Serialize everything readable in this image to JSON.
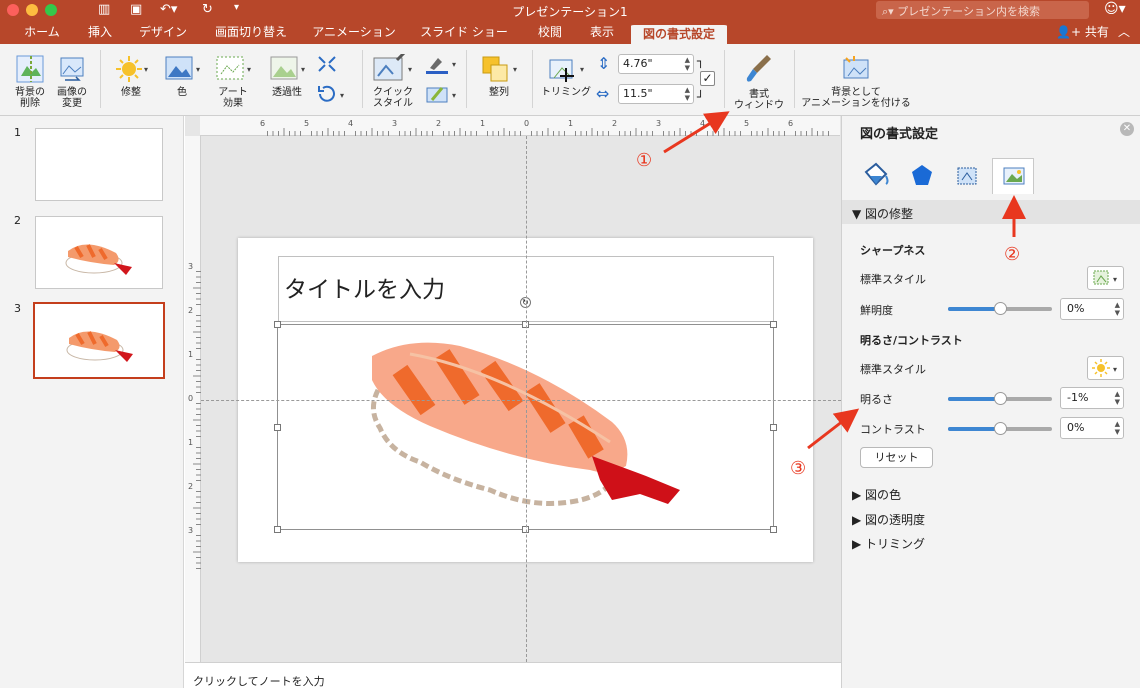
{
  "window": {
    "title": "プレゼンテーション1",
    "search_placeholder": "プレゼンテーション内を検索"
  },
  "tabs": [
    "ホーム",
    "挿入",
    "デザイン",
    "画面切り替え",
    "アニメーション",
    "スライド ショー",
    "校閲",
    "表示",
    "図の書式設定"
  ],
  "active_tab": "図の書式設定",
  "share_label": "共有",
  "ribbon": {
    "remove_bg": "背景の\n削除",
    "change_picture": "画像の\n変更",
    "corrections": "修整",
    "color": "色",
    "artistic_effects": "アート\n効果",
    "transparency": "透過性",
    "quick_styles": "クイック\nスタイル",
    "arrange": "整列",
    "crop": "トリミング",
    "height_value": "4.76\"",
    "width_value": "11.5\"",
    "format_pane": "書式\nウィンドウ",
    "animate_as_bg": "背景として\nアニメーションを付ける"
  },
  "slides": [
    {
      "number": "1"
    },
    {
      "number": "2"
    },
    {
      "number": "3",
      "selected": true
    }
  ],
  "slide": {
    "title_placeholder": "タイトルを入力"
  },
  "ruler": {
    "h_labels": [
      "6",
      "5",
      "4",
      "3",
      "2",
      "1",
      "0",
      "1",
      "2",
      "3",
      "4",
      "5",
      "6"
    ],
    "v_labels": [
      "3",
      "2",
      "1",
      "0",
      "1",
      "2",
      "3"
    ]
  },
  "notes_placeholder": "クリックしてノートを入力",
  "panel": {
    "title": "図の書式設定",
    "section": "図の修整",
    "sharpness_heading": "シャープネス",
    "preset_label": "標準スタイル",
    "sharpness_label": "鮮明度",
    "sharpness_value": "0%",
    "sharpness_level": 0.5,
    "bc_heading": "明るさ/コントラスト",
    "preset_label2": "標準スタイル",
    "brightness_label": "明るさ",
    "brightness_value": "-1%",
    "brightness_level": 0.5,
    "contrast_label": "コントラスト",
    "contrast_value": "0%",
    "contrast_level": 0.5,
    "reset_label": "リセット",
    "collapsed_sections": [
      "図の色",
      "図の透明度",
      "トリミング"
    ]
  },
  "annotations": [
    "①",
    "②",
    "③"
  ],
  "colors": {
    "accent": "#b7472a",
    "annotation": "#e8371f",
    "slider_fill": "#3d86d2"
  }
}
